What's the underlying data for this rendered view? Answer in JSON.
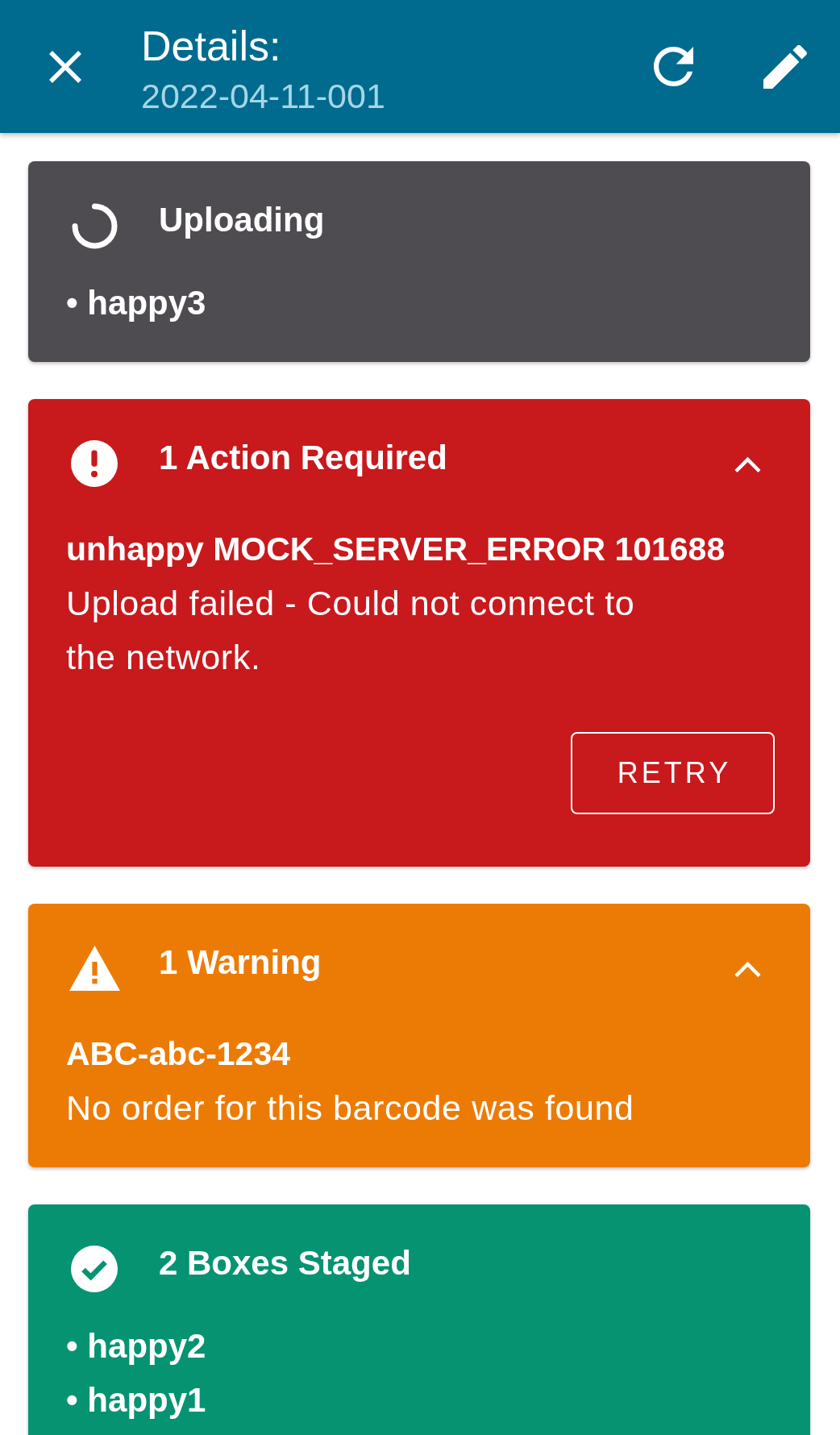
{
  "header": {
    "title": "Details:",
    "subtitle": "2022-04-11-001"
  },
  "cards": [
    {
      "kind": "uploading",
      "title": "Uploading",
      "items": [
        "• happy3"
      ]
    },
    {
      "kind": "error",
      "title": "1 Action Required",
      "expanded": true,
      "messages": [
        {
          "heading": "unhappy MOCK_SERVER_ERROR 101688",
          "text": "Upload failed - Could not connect to the network."
        }
      ],
      "button": "RETRY"
    },
    {
      "kind": "warning",
      "title": "1 Warning",
      "expanded": true,
      "messages": [
        {
          "heading": "ABC-abc-1234",
          "text": "No order for this barcode was found"
        }
      ]
    },
    {
      "kind": "success",
      "title": "2 Boxes Staged",
      "items": [
        "• happy2",
        "• happy1"
      ]
    }
  ]
}
